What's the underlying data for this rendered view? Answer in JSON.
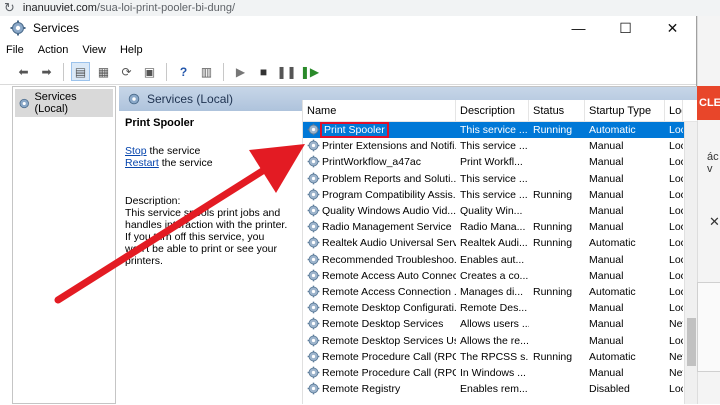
{
  "browser": {
    "host": "inanuuviet.com",
    "path": "/sua-loi-print-pooler-bi-dung/"
  },
  "background_page": {
    "banner_text": "CLE",
    "snippet": "ác v",
    "close_glyph": "✕"
  },
  "window": {
    "title": "Services",
    "minimize": "—",
    "maximize": "☐",
    "close": "✕"
  },
  "menu": [
    "File",
    "Action",
    "View",
    "Help"
  ],
  "tree": {
    "root_label": "Services (Local)"
  },
  "main": {
    "header": "Services (Local)"
  },
  "details": {
    "service_name": "Print Spooler",
    "stop_link": "Stop",
    "stop_rest": " the service",
    "restart_link": "Restart",
    "restart_rest": " the service",
    "description_label": "Description:",
    "description": "This service spools print jobs and handles interaction with the printer. If you turn off this service, you won't be able to print or see your printers."
  },
  "columns": [
    "Name",
    "Description",
    "Status",
    "Startup Type",
    "Log"
  ],
  "services": [
    {
      "name": "Print Spooler",
      "desc": "This service ...",
      "status": "Running",
      "startup": "Automatic",
      "log": "Loc",
      "selected": true
    },
    {
      "name": "Printer Extensions and Notifi...",
      "desc": "This service ...",
      "status": "",
      "startup": "Manual",
      "log": "Loc"
    },
    {
      "name": "PrintWorkflow_a47ac",
      "desc": "Print Workfl...",
      "status": "",
      "startup": "Manual",
      "log": "Loc"
    },
    {
      "name": "Problem Reports and Soluti...",
      "desc": "This service ...",
      "status": "",
      "startup": "Manual",
      "log": "Loc"
    },
    {
      "name": "Program Compatibility Assis...",
      "desc": "This service ...",
      "status": "Running",
      "startup": "Manual",
      "log": "Loc"
    },
    {
      "name": "Quality Windows Audio Vid...",
      "desc": "Quality Win...",
      "status": "",
      "startup": "Manual",
      "log": "Loc"
    },
    {
      "name": "Radio Management Service",
      "desc": "Radio Mana...",
      "status": "Running",
      "startup": "Manual",
      "log": "Loc"
    },
    {
      "name": "Realtek Audio Universal Serv...",
      "desc": "Realtek Audi...",
      "status": "Running",
      "startup": "Automatic",
      "log": "Loc"
    },
    {
      "name": "Recommended Troubleshoo...",
      "desc": "Enables aut...",
      "status": "",
      "startup": "Manual",
      "log": "Loc"
    },
    {
      "name": "Remote Access Auto Connec...",
      "desc": "Creates a co...",
      "status": "",
      "startup": "Manual",
      "log": "Loc"
    },
    {
      "name": "Remote Access Connection ...",
      "desc": "Manages di...",
      "status": "Running",
      "startup": "Automatic",
      "log": "Loc"
    },
    {
      "name": "Remote Desktop Configurati...",
      "desc": "Remote Des...",
      "status": "",
      "startup": "Manual",
      "log": "Loc"
    },
    {
      "name": "Remote Desktop Services",
      "desc": "Allows users ...",
      "status": "",
      "startup": "Manual",
      "log": "Net"
    },
    {
      "name": "Remote Desktop Services Us...",
      "desc": "Allows the re...",
      "status": "",
      "startup": "Manual",
      "log": "Loc"
    },
    {
      "name": "Remote Procedure Call (RPC)",
      "desc": "The RPCSS s...",
      "status": "Running",
      "startup": "Automatic",
      "log": "Net"
    },
    {
      "name": "Remote Procedure Call (RPC)...",
      "desc": "In Windows ...",
      "status": "",
      "startup": "Manual",
      "log": "Net"
    },
    {
      "name": "Remote Registry",
      "desc": "Enables rem...",
      "status": "",
      "startup": "Disabled",
      "log": "Loc"
    }
  ],
  "colors": {
    "selection": "#0078d7",
    "highlight_box": "#e0102a",
    "arrow": "#e31b23",
    "link": "#0645ad"
  }
}
